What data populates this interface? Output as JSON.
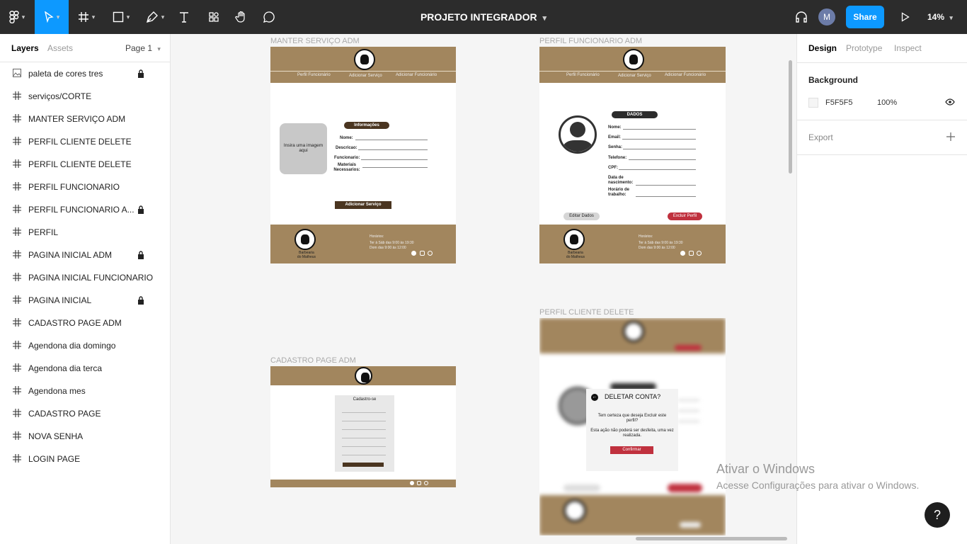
{
  "toolbar": {
    "doc_title": "PROJETO INTEGRADOR",
    "avatar_initial": "M",
    "share_label": "Share",
    "zoom": "14%"
  },
  "left_panel": {
    "tabs": [
      "Layers",
      "Assets"
    ],
    "page_selector": "Page 1",
    "layers": [
      {
        "name": "paleta de cores tres",
        "icon": "image-icon",
        "locked": true
      },
      {
        "name": "serviços/CORTE",
        "icon": "frame-icon",
        "locked": false
      },
      {
        "name": "MANTER SERVIÇO ADM",
        "icon": "frame-icon",
        "locked": false
      },
      {
        "name": "PERFIL CLIENTE DELETE",
        "icon": "frame-icon",
        "locked": false
      },
      {
        "name": "PERFIL CLIENTE DELETE",
        "icon": "frame-icon",
        "locked": false
      },
      {
        "name": "PERFIL FUNCIONARIO",
        "icon": "frame-icon",
        "locked": false
      },
      {
        "name": "PERFIL FUNCIONARIO A...",
        "icon": "frame-icon",
        "locked": true
      },
      {
        "name": "PERFIL",
        "icon": "frame-icon",
        "locked": false
      },
      {
        "name": "PAGINA INICIAL ADM",
        "icon": "frame-icon",
        "locked": true
      },
      {
        "name": "PAGINA INICIAL FUNCIONARIO",
        "icon": "frame-icon",
        "locked": false
      },
      {
        "name": "PAGINA INICIAL",
        "icon": "frame-icon",
        "locked": true
      },
      {
        "name": "CADASTRO PAGE ADM",
        "icon": "frame-icon",
        "locked": false
      },
      {
        "name": "Agendona dia domingo",
        "icon": "frame-icon",
        "locked": false
      },
      {
        "name": "Agendona dia terca",
        "icon": "frame-icon",
        "locked": false
      },
      {
        "name": "Agendona mes",
        "icon": "frame-icon",
        "locked": false
      },
      {
        "name": "CADASTRO PAGE",
        "icon": "frame-icon",
        "locked": false
      },
      {
        "name": "NOVA SENHA",
        "icon": "frame-icon",
        "locked": false
      },
      {
        "name": "LOGIN PAGE",
        "icon": "frame-icon",
        "locked": false
      }
    ]
  },
  "right_panel": {
    "tabs": [
      "Design",
      "Prototype",
      "Inspect"
    ],
    "background_label": "Background",
    "background_hex": "F5F5F5",
    "background_opacity": "100%",
    "export_label": "Export"
  },
  "canvas": {
    "frames": {
      "manter": {
        "label": "MANTER SERVIÇO ADM",
        "nav": [
          "Perfil Funcionário",
          "Adicionar Serviço",
          "Adicionar Funcionário"
        ],
        "image_placeholder": "Insira uma imagem aqui",
        "section_title": "Informações",
        "fields": [
          "Nome:",
          "Descricao:",
          "Funcionario:",
          "Materiais Necessarios:"
        ],
        "button": "Adicionar Serviço",
        "footer_hours_title": "Horários:",
        "footer_hours_1": "Ter à Sáb das 9:00 às 19:30",
        "footer_hours_2": "Dom das 9:00 às 12:00",
        "footer_name": "Barbearia do Matheus"
      },
      "funcionario": {
        "label": "PERFIL FUNCIONARIO ADM",
        "nav": [
          "Perfil Funcionário",
          "Adicionar Serviço",
          "Adicionar Funcionário"
        ],
        "section_title": "DADOS",
        "fields": [
          "Nome:",
          "Email:",
          "Senha:",
          "Telefone:",
          "CPF:",
          "Data de nascimento:",
          "Horário de trabalho:"
        ],
        "edit_button": "Editar Dados",
        "delete_button": "Excluir Perfil",
        "footer_hours_title": "Horários:",
        "footer_hours_1": "Ter à Sáb das 9:00 às 19:30",
        "footer_hours_2": "Dom das 9:00 às 12:00",
        "footer_name": "Barbearia do Matheus"
      },
      "cadastro": {
        "label": "CADASTRO PAGE ADM",
        "form_title": "Cadastro-se"
      },
      "cliente_delete": {
        "label": "PERFIL CLIENTE DELETE",
        "dialog_title": "DELETAR CONTA?",
        "dialog_question": "Tem certeza que deseja Excluir este perfil?",
        "dialog_warning": "Esta ação não poderá ser desfeita, uma vez realizada.",
        "confirm_button": "Confirmar"
      }
    }
  },
  "watermark": {
    "title": "Ativar o Windows",
    "subtitle": "Acesse Configurações para ativar o Windows."
  },
  "help_label": "?",
  "colors": {
    "toolbar_bg": "#2c2c2c",
    "accent": "#0d99ff",
    "brand_brown": "#a2865e",
    "dark_brown": "#4a3520",
    "danger": "#c0313e"
  }
}
